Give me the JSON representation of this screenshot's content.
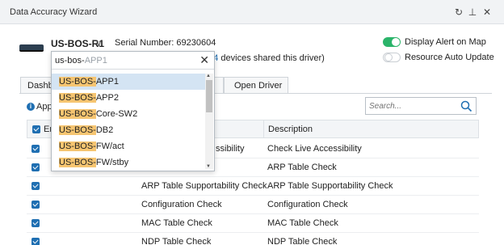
{
  "window": {
    "title": "Data Accuracy Wizard",
    "controls": {
      "refresh": "↻",
      "pin": "⊥",
      "close": "✕"
    }
  },
  "device": {
    "name": "US-BOS-R1",
    "chevron": "∨",
    "serial": "Serial Number: 69230604",
    "shared_count": "104",
    "shared_suffix": " devices shared this driver)"
  },
  "toggles": {
    "display_alert": {
      "label": "Display Alert on Map",
      "on": true
    },
    "resource_auto_update": {
      "label": "Resource Auto Update",
      "on": false
    }
  },
  "tabs": [
    {
      "label": "Dashb",
      "active": false
    },
    {
      "label": "",
      "active": false
    },
    {
      "label": "Open Driver",
      "active": false
    }
  ],
  "apply_text": "Appl",
  "search": {
    "placeholder": "Search..."
  },
  "grid": {
    "headers": {
      "enable": "En",
      "description": "Description"
    },
    "rows": [
      {
        "check": "ssibility",
        "description": "Check Live Accessibility",
        "checked": true
      },
      {
        "check": "",
        "description": "ARP Table Check",
        "checked": true
      },
      {
        "check": "ARP Table Supportability Check",
        "description": "ARP Table Supportability Check",
        "checked": true
      },
      {
        "check": "Configuration Check",
        "description": "Configuration Check",
        "checked": true
      },
      {
        "check": "MAC Table Check",
        "description": "MAC Table Check",
        "checked": true
      },
      {
        "check": "NDP Table Check",
        "description": "NDP Table Check",
        "checked": true
      }
    ]
  },
  "dropdown": {
    "typed": "us-bos-",
    "suggestion": "APP1",
    "clear": "✕",
    "match_prefix": "US-BOS-",
    "items": [
      {
        "prefix": "US-BOS-",
        "rest": "APP1",
        "selected": true
      },
      {
        "prefix": "US-BOS-",
        "rest": "APP2",
        "selected": false
      },
      {
        "prefix": "US-BOS-",
        "rest": "Core-SW2",
        "selected": false
      },
      {
        "prefix": "US-BOS-",
        "rest": "DB2",
        "selected": false
      },
      {
        "prefix": "US-BOS-",
        "rest": "FW/act",
        "selected": false
      },
      {
        "prefix": "US-BOS-",
        "rest": "FW/stby",
        "selected": false
      }
    ]
  },
  "colors": {
    "accent": "#1f6fb2",
    "toggle_on": "#2bb46a",
    "match_highlight": "#f6c571",
    "selected_row": "#d4e4f3"
  }
}
